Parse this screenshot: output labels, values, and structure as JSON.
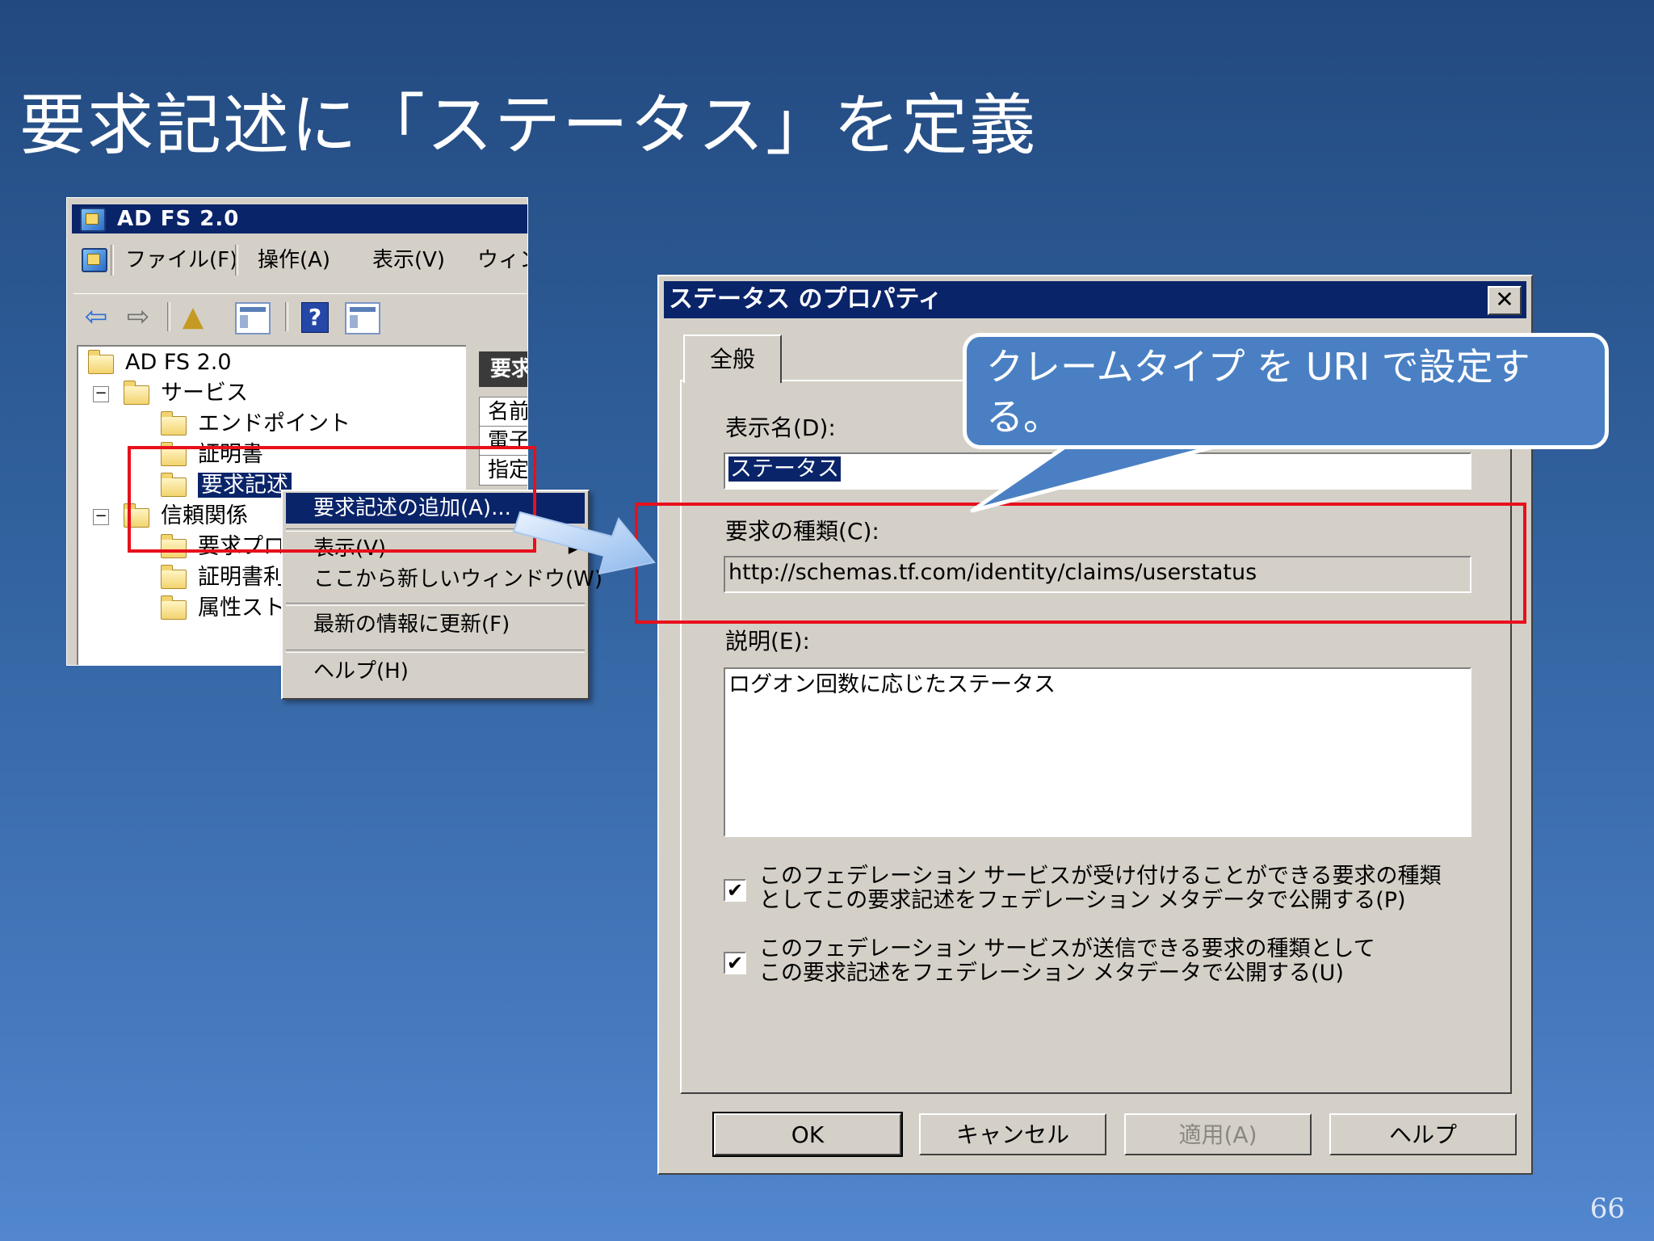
{
  "slide": {
    "title": "要求記述に「ステータス」を定義",
    "page_number": "66"
  },
  "mmc": {
    "window_title": "AD FS 2.0",
    "menu": [
      "ファイル(F)",
      "操作(A)",
      "表示(V)",
      "ウィン"
    ],
    "tree": {
      "root": "AD FS 2.0",
      "service": "サービス",
      "endpoints": "エンドポイント",
      "certificates": "証明書",
      "claim_descriptions": "要求記述",
      "trust": "信頼関係",
      "claims_provider": "要求プロ",
      "relying_party": "証明書利",
      "attribute_store": "属性スト"
    },
    "right_pane": {
      "header": "要求",
      "col1": "名前",
      "col2": "電子",
      "col3": "指定"
    }
  },
  "context_menu": {
    "add": "要求記述の追加(A)...",
    "view": "表示(V)",
    "new_window": "ここから新しいウィンドウ(W)",
    "refresh": "最新の情報に更新(F)",
    "help": "ヘルプ(H)"
  },
  "dialog": {
    "title": "ステータス のプロパティ",
    "close": "✕",
    "tab": "全般",
    "display_name_label": "表示名(D):",
    "display_name_value": "ステータス",
    "claim_type_label": "要求の種類(C):",
    "claim_type_value": "http://schemas.tf.com/identity/claims/userstatus",
    "description_label": "説明(E):",
    "description_value": "ログオン回数に応じたステータス",
    "checkbox1_line1": "このフェデレーション サービスが受け付けることができる要求の種類",
    "checkbox1_line2": "としてこの要求記述をフェデレーション メタデータで公開する(P)",
    "checkbox2_line1": "このフェデレーション サービスが送信できる要求の種類として",
    "checkbox2_line2": "この要求記述をフェデレーション メタデータで公開する(U)",
    "buttons": {
      "ok": "OK",
      "cancel": "キャンセル",
      "apply": "適用(A)",
      "help": "ヘルプ"
    }
  },
  "callout": {
    "text": "クレームタイプ を URI で設定する。"
  },
  "colors": {
    "accent_red": "#e8101c",
    "title_bar": "#0a246a",
    "callout_fill": "#4a80c3"
  }
}
